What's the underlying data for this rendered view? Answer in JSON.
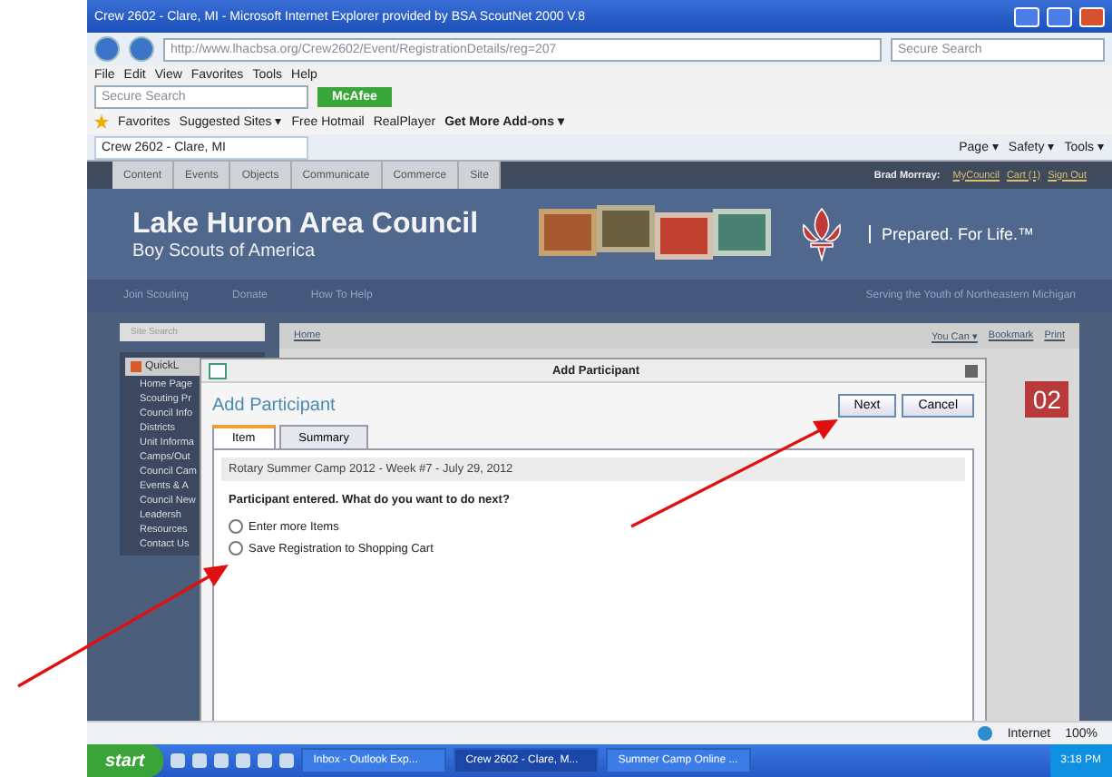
{
  "browser": {
    "title": "Crew 2602 - Clare, MI - Microsoft Internet Explorer provided by BSA ScoutNet 2000 V.8",
    "address": "http://www.lhacbsa.org/Crew2602/Event/RegistrationDetails/reg=207",
    "search_placeholder": "Secure Search",
    "menu": [
      "File",
      "Edit",
      "View",
      "Favorites",
      "Tools",
      "Help"
    ],
    "toolbar_search_placeholder": "Secure Search",
    "mcafee": "McAfee",
    "favorites": [
      "Favorites",
      "Suggested Sites ▾",
      "Free Hotmail",
      "RealPlayer",
      "Get More Add-ons ▾"
    ],
    "tab": "Crew 2602 - Clare, MI",
    "commands": [
      "Page ▾",
      "Safety ▾",
      "Tools ▾"
    ]
  },
  "site": {
    "topnav": [
      "Content",
      "Events",
      "Objects",
      "Communicate",
      "Commerce",
      "Site"
    ],
    "user": "Brad Morrray:",
    "user_links": [
      "MyCouncil",
      "Cart (1)",
      "Sign Out"
    ],
    "title": "Lake Huron Area Council",
    "subtitle": "Boy Scouts of America",
    "tagline": "Prepared. For Life.™",
    "subnav": [
      "Join Scouting",
      "Donate",
      "How To Help"
    ],
    "slogan": "Serving the Youth of Northeastern Michigan",
    "search_placeholder": "Site Search",
    "breadcrumb": "Home",
    "tools": [
      "You Can ▾",
      "Bookmark",
      "Print"
    ],
    "sidebar_title": "QuickL",
    "sidebar_items": [
      "Home Page",
      "Scouting Pr",
      "Council Info",
      "Districts",
      "Unit Informa",
      "Camps/Out",
      "Council Cam",
      "Events & A",
      "Council New",
      "Leadersh",
      "Resources",
      "Contact Us"
    ],
    "banner_fragment": "02"
  },
  "dialog": {
    "title": "Add Participant",
    "heading": "Add Participant",
    "buttons": [
      "Next",
      "Cancel"
    ],
    "tabs": [
      {
        "label": "Item",
        "selected": true
      },
      {
        "label": "Summary",
        "selected": false
      }
    ],
    "item": "Rotary Summer Camp 2012 - Week #7 - July 29, 2012",
    "prompt": "Participant entered. What do you want to do next?",
    "options": [
      {
        "label": "Enter more Items",
        "selected": false
      },
      {
        "label": "Save Registration to Shopping Cart",
        "selected": false
      }
    ]
  },
  "status_bar": {
    "zone": "Internet",
    "zoom": "100%"
  },
  "taskbar": {
    "start": "start",
    "windows": [
      {
        "label": "Inbox - Outlook Exp...",
        "selected": false
      },
      {
        "label": "Crew 2602 - Clare, M...",
        "selected": true
      },
      {
        "label": "Summer Camp Online ...",
        "selected": false
      }
    ],
    "clock": "3:18 PM"
  }
}
